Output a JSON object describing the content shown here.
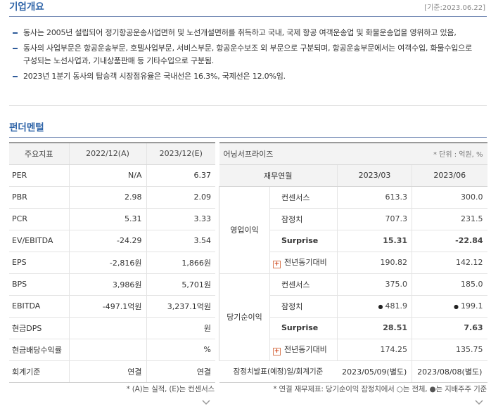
{
  "overview": {
    "title": "기업개요",
    "date": "[기준:2023.06.22]",
    "bullets": [
      "동사는 2005년 설립되어 정기항공운송사업면허 및 노선개설면허를 취득하고 국내, 국제 항공 여객운송업 및 화물운송업을 영위하고 있음,",
      "동사의 사업부문은 항공운송부문, 호텔사업부문, 서비스부문, 항공운수보조 외 부문으로 구분되며, 항공운송부문에서는 여객수입, 화물수입으로 구성되는 노선사업과, 기내상품판매 등 기타수입으로 구분됨.",
      "2023년 1분기 동사의 탑승객 시장점유율은 국내선은 16.3%, 국제선은 12.0%임."
    ]
  },
  "fundamentals": {
    "title": "펀더멘털",
    "headers": [
      "주요지표",
      "2022/12(A)",
      "2023/12(E)"
    ],
    "rows": [
      {
        "label": "PER",
        "a": "N/A",
        "e": "6.37"
      },
      {
        "label": "PBR",
        "a": "2.98",
        "e": "2.09"
      },
      {
        "label": "PCR",
        "a": "5.31",
        "e": "3.33"
      },
      {
        "label": "EV/EBITDA",
        "a": "-24.29",
        "e": "3.54"
      },
      {
        "label": "EPS",
        "a": "-2,816원",
        "e": "1,866원"
      },
      {
        "label": "BPS",
        "a": "3,986원",
        "e": "5,701원"
      },
      {
        "label": "EBITDA",
        "a": "-497.1억원",
        "e": "3,237.1억원"
      },
      {
        "label": "현금DPS",
        "a": "",
        "e": "원"
      },
      {
        "label": "현금배당수익률",
        "a": "",
        "e": "%"
      },
      {
        "label": "회계기준",
        "a": "연결",
        "e": "연결"
      }
    ],
    "footnote": "* (A)는 실적, (E)는 컨센서스"
  },
  "earnings": {
    "title": "어닝서프라이즈",
    "unit": "* 단위 : 억원, %",
    "headers": {
      "col1": "재무연월",
      "p1": "2023/03",
      "p2": "2023/06"
    },
    "groups": [
      {
        "name": "영업이익",
        "rows": [
          {
            "label": "컨센서스",
            "v1": "613.3",
            "v2": "300.0"
          },
          {
            "label": "잠정치",
            "v1": "707.3",
            "v2": "231.5"
          },
          {
            "label": "Surprise",
            "v1": "15.31",
            "v2": "-22.84"
          },
          {
            "label": "전년동기대비",
            "v1": "190.82",
            "v2": "142.12"
          }
        ]
      },
      {
        "name": "당기순이익",
        "rows": [
          {
            "label": "컨센서스",
            "v1": "375.0",
            "v2": "185.0"
          },
          {
            "label": "잠정치",
            "v1": "481.9",
            "v2": "199.1"
          },
          {
            "label": "Surprise",
            "v1": "28.51",
            "v2": "7.63"
          },
          {
            "label": "전년동기대비",
            "v1": "174.25",
            "v2": "135.75"
          }
        ]
      }
    ],
    "last_row": {
      "label": "잠정치발표(예정)일/회계기준",
      "v1": "2023/05/09(별도)",
      "v2": "2023/08/08(별도)"
    },
    "footnote": "* 연결 재무제표: 당기순이익 잠정치에서 ○는 전체, ●는 지배주주 기준"
  },
  "colors": {
    "accent_blue": "#2f64a8",
    "negative": "#1f5bbf",
    "positive": "#d0202a"
  },
  "icons": {
    "bullet": "dash-bullet-icon",
    "plus": "plus-box-icon",
    "expand": "chevron-down-icon"
  }
}
